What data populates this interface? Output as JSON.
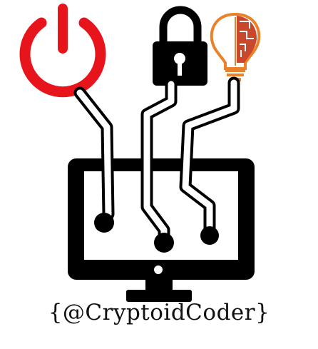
{
  "logo": {
    "handle": "{@CryptoidCoder}",
    "icons": {
      "power": "power-icon",
      "lock": "padlock-icon",
      "bulb": "lightbulb-icon",
      "monitor": "monitor-icon"
    },
    "colors": {
      "power": "#e8141b",
      "ink": "#000000",
      "bulb_orange": "#e9822a",
      "bulb_inner": "#c9472c",
      "background": "#ffffff"
    }
  }
}
